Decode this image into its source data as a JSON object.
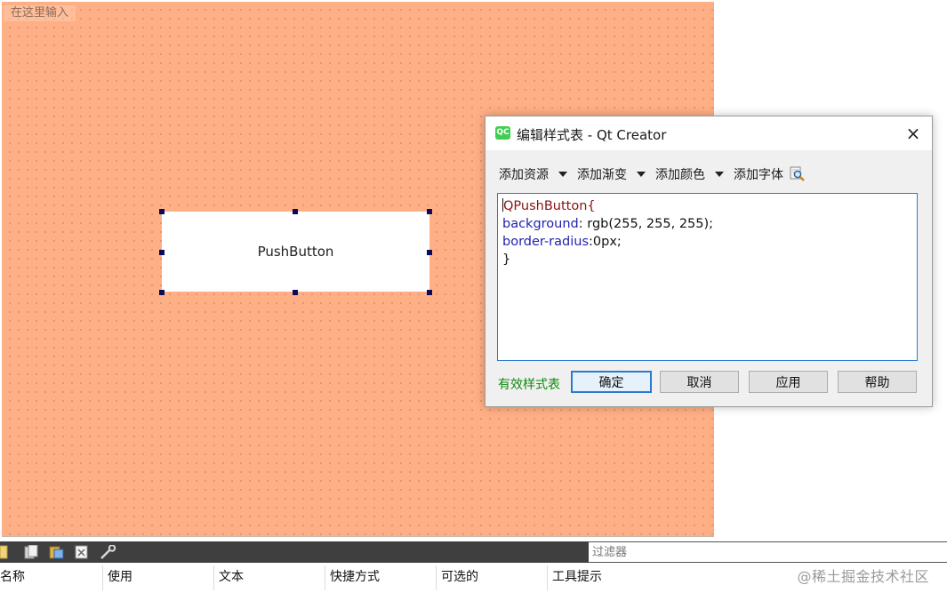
{
  "canvas": {
    "title": "在这里输入",
    "push_button_label": "PushButton",
    "background_color": "#ffaf85"
  },
  "dialog": {
    "logo_text": "QC",
    "title": "编辑样式表 - Qt Creator",
    "close_icon": "×",
    "toolbar": {
      "add_resource": "添加资源",
      "add_gradient": "添加渐变",
      "add_color": "添加颜色",
      "add_font": "添加字体"
    },
    "code": {
      "selector": "QPushButton{",
      "line2_prop": "background",
      "line2_value": ": rgb(255, 255, 255);",
      "line3_prop": "border-radius",
      "line3_value": ":0px;",
      "closing": "}"
    },
    "valid_label": "有效样式表",
    "buttons": {
      "ok": "确定",
      "cancel": "取消",
      "apply": "应用",
      "help": "帮助"
    },
    "colors": {
      "valid": "#0e8a0e",
      "selector": "#8b1111",
      "property": "#1f1fb0",
      "focus": "#2a7bd0"
    }
  },
  "action_editor": {
    "icons": [
      "new-file-icon",
      "copy-icon",
      "paste-icon",
      "delete-icon",
      "wrench-icon"
    ],
    "filter_placeholder": "过滤器",
    "columns": [
      "名称",
      "使用",
      "文本",
      "快捷方式",
      "可选的",
      "工具提示"
    ]
  },
  "watermark": "@稀土掘金技术社区"
}
